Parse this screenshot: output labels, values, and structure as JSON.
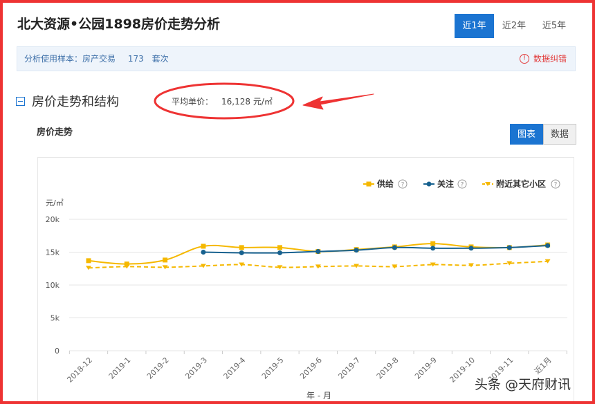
{
  "page": {
    "title": "北大资源•公园1898房价走势分析",
    "range_tabs": [
      "近1年",
      "近2年",
      "近5年"
    ]
  },
  "sample": {
    "label": "分析使用样本：房产交易",
    "count": "173",
    "unit": "套次",
    "report_label": "数据纠错"
  },
  "section": {
    "title": "房价走势和结构",
    "avg_label": "平均单价：",
    "avg_value": "16,128 元/㎡"
  },
  "chart_header": {
    "subtitle": "房价走势",
    "view_buttons": [
      "图表",
      "数据"
    ]
  },
  "watermark": "头条 @天府财讯",
  "colors": {
    "accent": "#1b74d1",
    "supply": "#f5b800",
    "attention": "#17618f",
    "nearby": "#f5b800",
    "annotation": "#ee3333"
  },
  "chart_data": {
    "type": "line",
    "ylabel": "元/㎡",
    "xlabel": "年 - 月",
    "ylim": [
      0,
      20000
    ],
    "y_ticks": [
      0,
      5000,
      10000,
      15000,
      20000
    ],
    "y_tick_labels": [
      "0",
      "5k",
      "10k",
      "15k",
      "20k"
    ],
    "categories": [
      "2018-12",
      "2019-1",
      "2019-2",
      "2019-3",
      "2019-4",
      "2019-5",
      "2019-6",
      "2019-7",
      "2019-8",
      "2019-9",
      "2019-10",
      "2019-11",
      "近1月"
    ],
    "legend_position": "top-right",
    "grid": true,
    "series": [
      {
        "name": "供给",
        "style": "solid",
        "marker": "square",
        "color": "#f5b800",
        "values": [
          13700,
          13200,
          13800,
          15900,
          15700,
          15700,
          15100,
          15400,
          15800,
          16300,
          15800,
          15700,
          16100
        ]
      },
      {
        "name": "关注",
        "style": "solid",
        "marker": "circle",
        "color": "#17618f",
        "values": [
          null,
          null,
          null,
          15000,
          14900,
          14900,
          15100,
          15300,
          15700,
          15600,
          15600,
          15700,
          16000
        ]
      },
      {
        "name": "附近其它小区",
        "style": "dashed",
        "marker": "triangle",
        "color": "#f5b800",
        "values": [
          12600,
          12800,
          12700,
          12900,
          13100,
          12700,
          12800,
          12900,
          12800,
          13100,
          13000,
          13300,
          13600
        ]
      }
    ]
  }
}
